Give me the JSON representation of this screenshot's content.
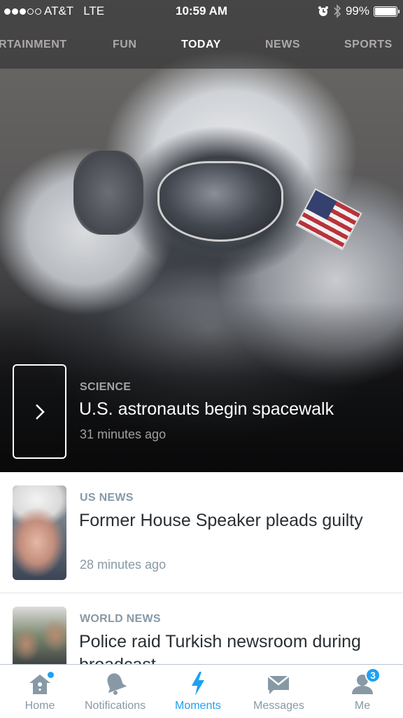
{
  "status_bar": {
    "signal_dots_filled": 3,
    "signal_dots_total": 5,
    "carrier": "AT&T",
    "network": "LTE",
    "time": "10:59 AM",
    "alarm_icon": "alarm-clock-icon",
    "bluetooth_icon": "bluetooth-icon",
    "battery_percent": "99%",
    "battery_level": 0.99
  },
  "category_tabs": [
    {
      "label": "RTAINMENT",
      "active": false
    },
    {
      "label": "FUN",
      "active": false
    },
    {
      "label": "TODAY",
      "active": true
    },
    {
      "label": "NEWS",
      "active": false
    },
    {
      "label": "SPORTS",
      "active": false
    }
  ],
  "hero": {
    "category": "SCIENCE",
    "title": "U.S. astronauts begin spacewalk",
    "time": "31 minutes ago"
  },
  "items": [
    {
      "category": "US NEWS",
      "title": "Former House Speaker pleads guilty",
      "time": "28 minutes ago"
    },
    {
      "category": "WORLD NEWS",
      "title": "Police raid Turkish newsroom during broadcast",
      "time": ""
    }
  ],
  "tab_bar": [
    {
      "label": "Home",
      "icon": "home-icon",
      "active": false,
      "dot": true
    },
    {
      "label": "Notifications",
      "icon": "bell-icon",
      "active": false
    },
    {
      "label": "Moments",
      "icon": "lightning-icon",
      "active": true
    },
    {
      "label": "Messages",
      "icon": "envelope-icon",
      "active": false
    },
    {
      "label": "Me",
      "icon": "person-icon",
      "active": false,
      "badge": "3"
    }
  ],
  "colors": {
    "accent": "#1da1f2",
    "muted": "#8899a6",
    "text": "#292f33"
  }
}
